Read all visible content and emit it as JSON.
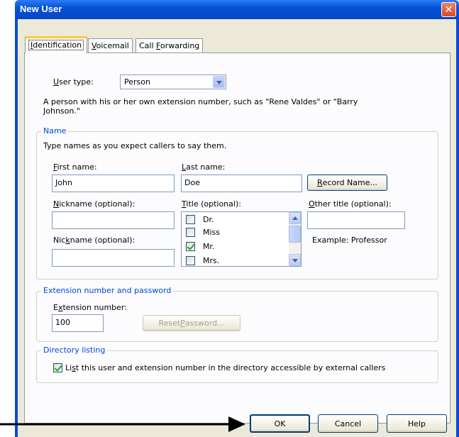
{
  "window": {
    "title": "New User",
    "close_glyph": "✕"
  },
  "tabs": [
    {
      "pre": "",
      "u": "I",
      "post": "dentification",
      "active": true
    },
    {
      "pre": "",
      "u": "V",
      "post": "oicemail",
      "active": false
    },
    {
      "pre": "Call ",
      "u": "F",
      "post": "orwarding",
      "active": false
    }
  ],
  "user_type": {
    "label_u": "U",
    "label_rest": "ser type:",
    "value": "Person",
    "description": "A person with his or her own extension number, such as \"Rene Valdes\" or \"Barry Johnson.\""
  },
  "name_group": {
    "legend": "Name",
    "hint": "Type names as you expect callers to say them.",
    "first_name": {
      "label_u": "F",
      "label_rest": "irst name:",
      "value": "John"
    },
    "last_name": {
      "label_u": "L",
      "label_rest": "ast name:",
      "value": "Doe"
    },
    "record_button": {
      "u": "R",
      "rest": "ecord Name..."
    },
    "nickname1": {
      "label_u": "N",
      "label_rest": "ickname (optional):",
      "value": ""
    },
    "nickname2": {
      "label_pre": "Nic",
      "label_u": "k",
      "label_rest": "name (optional):",
      "value": ""
    },
    "title": {
      "label_u": "T",
      "label_rest": "itle (optional):"
    },
    "title_options": [
      {
        "label": "Dr.",
        "checked": false
      },
      {
        "label": "Miss",
        "checked": false
      },
      {
        "label": "Mr.",
        "checked": true
      },
      {
        "label": "Mrs.",
        "checked": false
      }
    ],
    "other_title": {
      "label_u": "O",
      "label_rest": "ther title (optional):",
      "value": "",
      "example": "Example: Professor"
    }
  },
  "extension_group": {
    "legend": "Extension number and password",
    "ext_label_pre": "E",
    "ext_label_u": "x",
    "ext_label_rest": "tension number:",
    "ext_value": "100",
    "reset_pre": "Reset ",
    "reset_u": "P",
    "reset_rest": "assword..."
  },
  "directory_group": {
    "legend": "Directory listing",
    "list_pre": "Li",
    "list_u": "s",
    "list_rest": "t this user and extension number in the directory accessible by external callers",
    "checked": true
  },
  "footer": {
    "ok": "OK",
    "cancel": "Cancel",
    "help": "Help"
  },
  "colors": {
    "titlebar": "#0652d8",
    "dialog_bg": "#ece9d8",
    "panel_bg": "#fcfcfe",
    "group_legend": "#0046d5",
    "tab_highlight": "#ffc83c"
  }
}
